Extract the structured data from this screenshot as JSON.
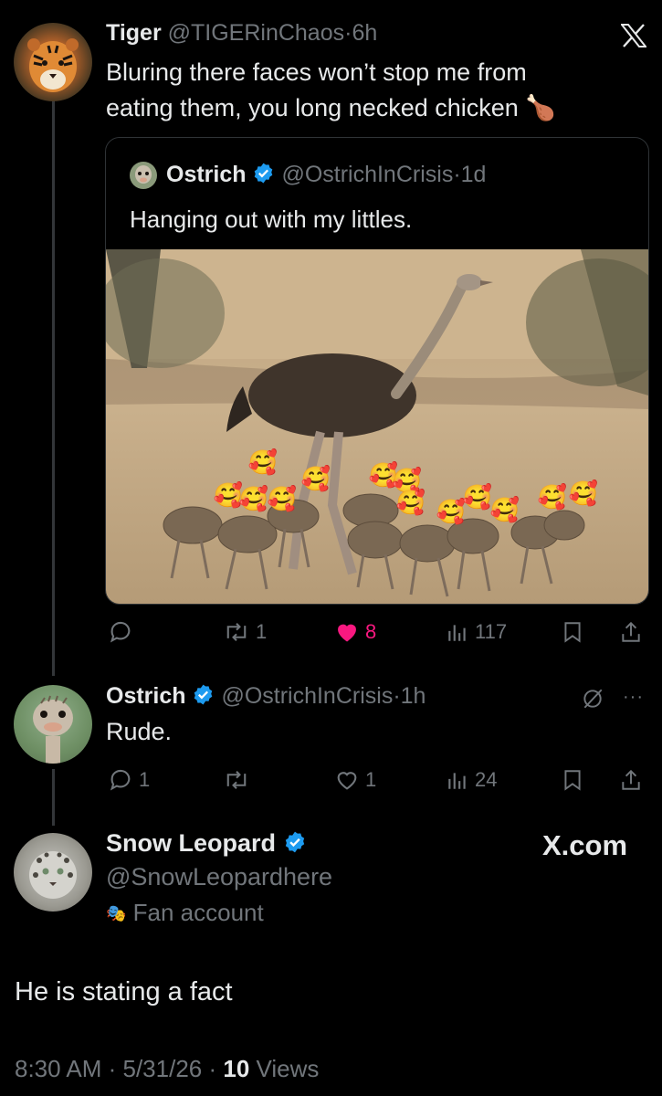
{
  "top_tweet": {
    "author_name": "Tiger",
    "handle": "@TIGERinChaos",
    "sep": "·",
    "time": "6h",
    "text_line1": "Bluring there faces won’t stop me from",
    "text_line2": "eating them, you long necked chicken",
    "emoji": "🍗",
    "close_icon": "x-logo-icon",
    "quoted": {
      "author_name": "Ostrich",
      "handle": "@OstrichInCrisis",
      "sep": "·",
      "time": "1d",
      "text": "Hanging out with my littles.",
      "image_emoji": "🥰"
    },
    "actions": {
      "reply_count": "",
      "retweet_count": "1",
      "like_count": "8",
      "views_count": "117"
    }
  },
  "reply_tweet": {
    "author_name": "Ostrich",
    "handle": "@OstrichInCrisis",
    "sep": "·",
    "time": "1h",
    "text": "Rude.",
    "more": "···",
    "actions": {
      "reply_count": "1",
      "retweet_count": "",
      "like_count": "1",
      "views_count": "24"
    }
  },
  "main_tweet": {
    "author_name": "Snow Leopard",
    "handle": "@SnowLeopardhere",
    "badge_label": "Fan account",
    "badge_icon": "🎭",
    "brand": "X.com",
    "text": "He is stating a fact",
    "timestamp": "8:30 AM · 5/31/26 · ",
    "views_count": "10",
    "views_label": " Views"
  },
  "colors": {
    "background": "#000000",
    "text": "#e7e9ea",
    "muted": "#71767b",
    "verified": "#1d9bf0",
    "like": "#f91880",
    "border": "#2f3336"
  }
}
